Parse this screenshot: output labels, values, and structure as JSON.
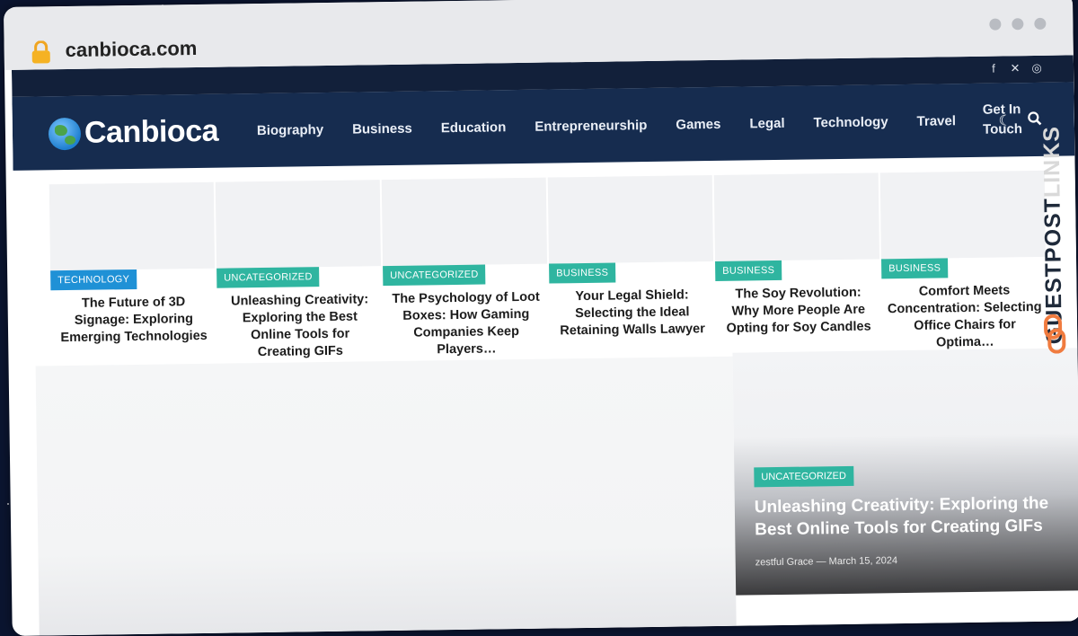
{
  "browser": {
    "url": "canbioca.com"
  },
  "topbar": {
    "social_icons": [
      "facebook-icon",
      "x-icon",
      "instagram-icon"
    ]
  },
  "site": {
    "logo_text": "Canbioca"
  },
  "nav": {
    "items": [
      "Biography",
      "Business",
      "Education",
      "Entrepreneurship",
      "Games",
      "Legal",
      "Technology",
      "Travel",
      "Get In Touch"
    ],
    "tool_icons": [
      "moon-icon",
      "search-icon"
    ]
  },
  "cards": [
    {
      "category": "TECHNOLOGY",
      "title": "The Future of 3D Signage: Exploring Emerging Technologies"
    },
    {
      "category": "UNCATEGORIZED",
      "title": "Unleashing Creativity: Exploring the Best Online Tools for Creating GIFs"
    },
    {
      "category": "UNCATEGORIZED",
      "title": "The Psychology of Loot Boxes: How Gaming Companies Keep Players…"
    },
    {
      "category": "BUSINESS",
      "title": "Your Legal Shield: Selecting the Ideal Retaining Walls Lawyer"
    },
    {
      "category": "BUSINESS",
      "title": "The Soy Revolution: Why More People Are Opting for Soy Candles"
    },
    {
      "category": "BUSINESS",
      "title": "Comfort Meets Concentration: Selecting Office Chairs for Optima…"
    }
  ],
  "hero": {
    "category": "UNCATEGORIZED",
    "title": "Unleashing Creativity: Exploring the Best Online Tools for Creating GIFs",
    "author": "zestful Grace",
    "separator": "—",
    "date": "March 15, 2024"
  },
  "watermark": {
    "word1": "GUESTPOST",
    "word2": "LINKS"
  },
  "colors": {
    "nav_bg": "#162c4f",
    "topbar_bg": "#12203a",
    "badge_blue": "#1f91d6",
    "badge_green": "#2fb5a0"
  }
}
